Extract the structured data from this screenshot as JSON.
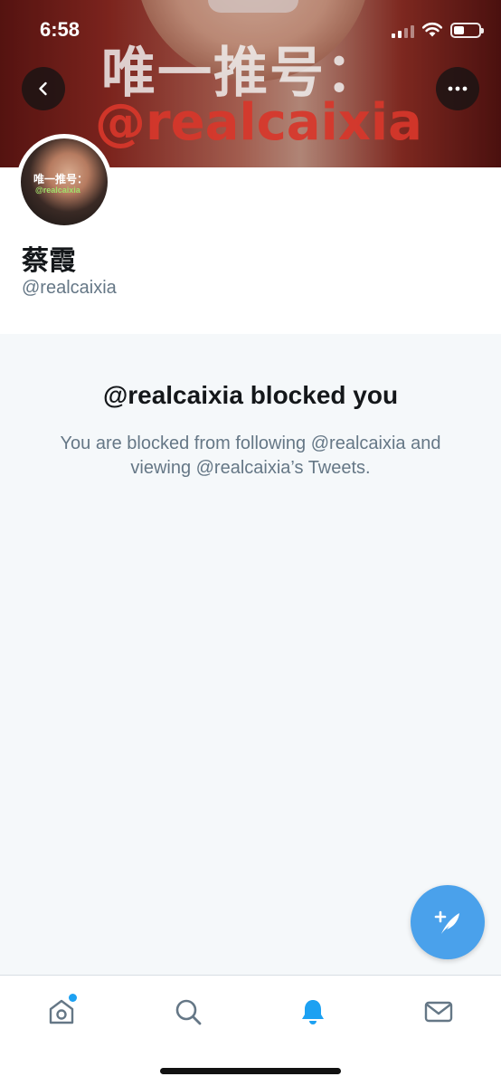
{
  "status_bar": {
    "time": "6:58"
  },
  "banner": {
    "overlay_line_1": "唯一推号：",
    "overlay_line_2": "@realcaixia"
  },
  "profile": {
    "avatar_text_line_1": "唯一推号：",
    "avatar_text_line_2": "@realcaixia",
    "display_name": "蔡霞",
    "handle": "@realcaixia"
  },
  "blocked": {
    "title": "@realcaixia blocked you",
    "description": "You are blocked from following @realcaixia and viewing @realcaixia’s Tweets."
  },
  "tab_bar": {
    "items": [
      {
        "icon": "home-icon",
        "has_badge": true
      },
      {
        "icon": "search-icon"
      },
      {
        "icon": "notifications-bell-icon",
        "active": true
      },
      {
        "icon": "messages-envelope-icon"
      }
    ]
  },
  "colors": {
    "accent": "#1da1f2",
    "fab": "#4aa1eb",
    "secondary_text": "#657786",
    "background": "#f5f8fa"
  }
}
